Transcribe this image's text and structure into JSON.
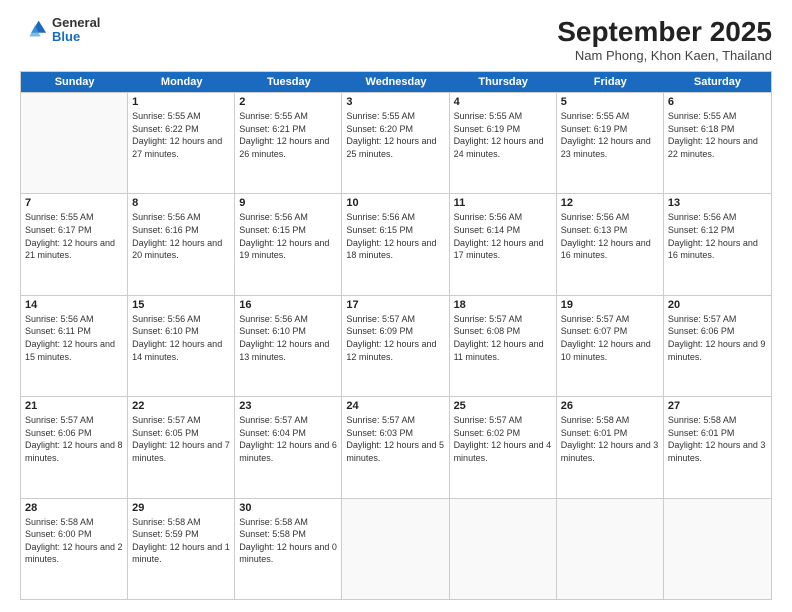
{
  "logo": {
    "general": "General",
    "blue": "Blue"
  },
  "title": "September 2025",
  "location": "Nam Phong, Khon Kaen, Thailand",
  "header_days": [
    "Sunday",
    "Monday",
    "Tuesday",
    "Wednesday",
    "Thursday",
    "Friday",
    "Saturday"
  ],
  "weeks": [
    [
      {
        "day": "",
        "sunrise": "",
        "sunset": "",
        "daylight": ""
      },
      {
        "day": "1",
        "sunrise": "Sunrise: 5:55 AM",
        "sunset": "Sunset: 6:22 PM",
        "daylight": "Daylight: 12 hours and 27 minutes."
      },
      {
        "day": "2",
        "sunrise": "Sunrise: 5:55 AM",
        "sunset": "Sunset: 6:21 PM",
        "daylight": "Daylight: 12 hours and 26 minutes."
      },
      {
        "day": "3",
        "sunrise": "Sunrise: 5:55 AM",
        "sunset": "Sunset: 6:20 PM",
        "daylight": "Daylight: 12 hours and 25 minutes."
      },
      {
        "day": "4",
        "sunrise": "Sunrise: 5:55 AM",
        "sunset": "Sunset: 6:19 PM",
        "daylight": "Daylight: 12 hours and 24 minutes."
      },
      {
        "day": "5",
        "sunrise": "Sunrise: 5:55 AM",
        "sunset": "Sunset: 6:19 PM",
        "daylight": "Daylight: 12 hours and 23 minutes."
      },
      {
        "day": "6",
        "sunrise": "Sunrise: 5:55 AM",
        "sunset": "Sunset: 6:18 PM",
        "daylight": "Daylight: 12 hours and 22 minutes."
      }
    ],
    [
      {
        "day": "7",
        "sunrise": "Sunrise: 5:55 AM",
        "sunset": "Sunset: 6:17 PM",
        "daylight": "Daylight: 12 hours and 21 minutes."
      },
      {
        "day": "8",
        "sunrise": "Sunrise: 5:56 AM",
        "sunset": "Sunset: 6:16 PM",
        "daylight": "Daylight: 12 hours and 20 minutes."
      },
      {
        "day": "9",
        "sunrise": "Sunrise: 5:56 AM",
        "sunset": "Sunset: 6:15 PM",
        "daylight": "Daylight: 12 hours and 19 minutes."
      },
      {
        "day": "10",
        "sunrise": "Sunrise: 5:56 AM",
        "sunset": "Sunset: 6:15 PM",
        "daylight": "Daylight: 12 hours and 18 minutes."
      },
      {
        "day": "11",
        "sunrise": "Sunrise: 5:56 AM",
        "sunset": "Sunset: 6:14 PM",
        "daylight": "Daylight: 12 hours and 17 minutes."
      },
      {
        "day": "12",
        "sunrise": "Sunrise: 5:56 AM",
        "sunset": "Sunset: 6:13 PM",
        "daylight": "Daylight: 12 hours and 16 minutes."
      },
      {
        "day": "13",
        "sunrise": "Sunrise: 5:56 AM",
        "sunset": "Sunset: 6:12 PM",
        "daylight": "Daylight: 12 hours and 16 minutes."
      }
    ],
    [
      {
        "day": "14",
        "sunrise": "Sunrise: 5:56 AM",
        "sunset": "Sunset: 6:11 PM",
        "daylight": "Daylight: 12 hours and 15 minutes."
      },
      {
        "day": "15",
        "sunrise": "Sunrise: 5:56 AM",
        "sunset": "Sunset: 6:10 PM",
        "daylight": "Daylight: 12 hours and 14 minutes."
      },
      {
        "day": "16",
        "sunrise": "Sunrise: 5:56 AM",
        "sunset": "Sunset: 6:10 PM",
        "daylight": "Daylight: 12 hours and 13 minutes."
      },
      {
        "day": "17",
        "sunrise": "Sunrise: 5:57 AM",
        "sunset": "Sunset: 6:09 PM",
        "daylight": "Daylight: 12 hours and 12 minutes."
      },
      {
        "day": "18",
        "sunrise": "Sunrise: 5:57 AM",
        "sunset": "Sunset: 6:08 PM",
        "daylight": "Daylight: 12 hours and 11 minutes."
      },
      {
        "day": "19",
        "sunrise": "Sunrise: 5:57 AM",
        "sunset": "Sunset: 6:07 PM",
        "daylight": "Daylight: 12 hours and 10 minutes."
      },
      {
        "day": "20",
        "sunrise": "Sunrise: 5:57 AM",
        "sunset": "Sunset: 6:06 PM",
        "daylight": "Daylight: 12 hours and 9 minutes."
      }
    ],
    [
      {
        "day": "21",
        "sunrise": "Sunrise: 5:57 AM",
        "sunset": "Sunset: 6:06 PM",
        "daylight": "Daylight: 12 hours and 8 minutes."
      },
      {
        "day": "22",
        "sunrise": "Sunrise: 5:57 AM",
        "sunset": "Sunset: 6:05 PM",
        "daylight": "Daylight: 12 hours and 7 minutes."
      },
      {
        "day": "23",
        "sunrise": "Sunrise: 5:57 AM",
        "sunset": "Sunset: 6:04 PM",
        "daylight": "Daylight: 12 hours and 6 minutes."
      },
      {
        "day": "24",
        "sunrise": "Sunrise: 5:57 AM",
        "sunset": "Sunset: 6:03 PM",
        "daylight": "Daylight: 12 hours and 5 minutes."
      },
      {
        "day": "25",
        "sunrise": "Sunrise: 5:57 AM",
        "sunset": "Sunset: 6:02 PM",
        "daylight": "Daylight: 12 hours and 4 minutes."
      },
      {
        "day": "26",
        "sunrise": "Sunrise: 5:58 AM",
        "sunset": "Sunset: 6:01 PM",
        "daylight": "Daylight: 12 hours and 3 minutes."
      },
      {
        "day": "27",
        "sunrise": "Sunrise: 5:58 AM",
        "sunset": "Sunset: 6:01 PM",
        "daylight": "Daylight: 12 hours and 3 minutes."
      }
    ],
    [
      {
        "day": "28",
        "sunrise": "Sunrise: 5:58 AM",
        "sunset": "Sunset: 6:00 PM",
        "daylight": "Daylight: 12 hours and 2 minutes."
      },
      {
        "day": "29",
        "sunrise": "Sunrise: 5:58 AM",
        "sunset": "Sunset: 5:59 PM",
        "daylight": "Daylight: 12 hours and 1 minute."
      },
      {
        "day": "30",
        "sunrise": "Sunrise: 5:58 AM",
        "sunset": "Sunset: 5:58 PM",
        "daylight": "Daylight: 12 hours and 0 minutes."
      },
      {
        "day": "",
        "sunrise": "",
        "sunset": "",
        "daylight": ""
      },
      {
        "day": "",
        "sunrise": "",
        "sunset": "",
        "daylight": ""
      },
      {
        "day": "",
        "sunrise": "",
        "sunset": "",
        "daylight": ""
      },
      {
        "day": "",
        "sunrise": "",
        "sunset": "",
        "daylight": ""
      }
    ]
  ]
}
